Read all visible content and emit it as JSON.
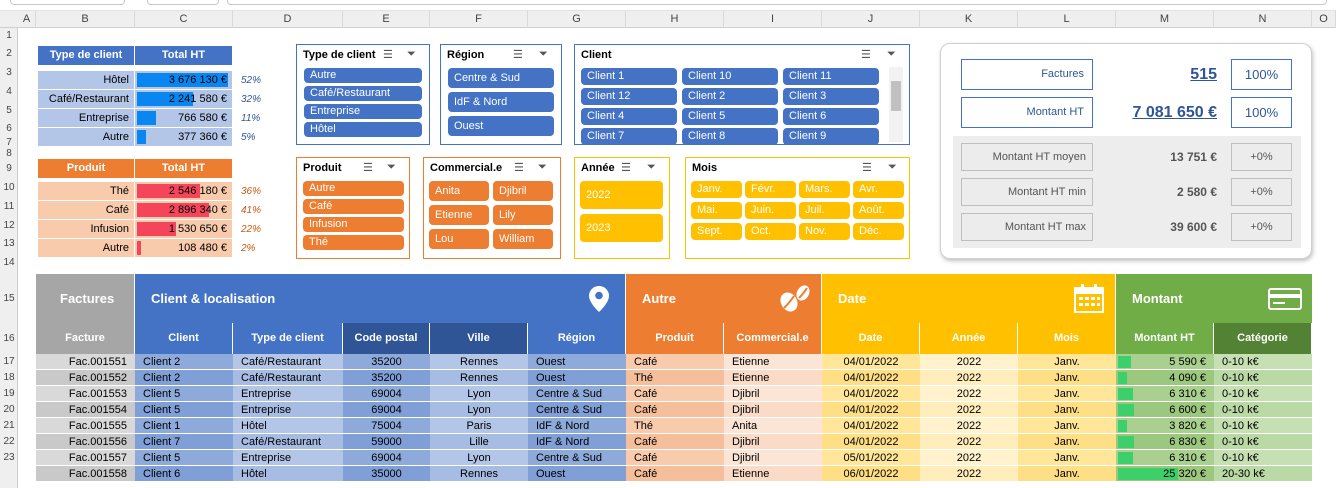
{
  "columns": [
    "A",
    "B",
    "C",
    "D",
    "E",
    "F",
    "G",
    "H",
    "I",
    "J",
    "K",
    "L",
    "M",
    "N",
    "O"
  ],
  "rows": [
    "1",
    "2",
    "3",
    "4",
    "5",
    "6",
    "7",
    "8",
    "9",
    "10",
    "11",
    "12",
    "13",
    "14",
    "15",
    "16",
    "17",
    "18",
    "19",
    "20",
    "21",
    "22",
    "23"
  ],
  "tc_header": {
    "label": "Type de client",
    "total": "Total HT"
  },
  "tc_rows": [
    {
      "label": "Hôtel",
      "value": "3 676 130 €",
      "pct": "52%",
      "bar": 0.52
    },
    {
      "label": "Café/Restaurant",
      "value": "2 241 580 €",
      "pct": "32%",
      "bar": 0.32
    },
    {
      "label": "Entreprise",
      "value": "766 580 €",
      "pct": "11%",
      "bar": 0.11
    },
    {
      "label": "Autre",
      "value": "377 360 €",
      "pct": "5%",
      "bar": 0.05
    }
  ],
  "pr_header": {
    "label": "Produit",
    "total": "Total HT"
  },
  "pr_rows": [
    {
      "label": "Thé",
      "value": "2 546 180 €",
      "pct": "36%",
      "bar": 0.36
    },
    {
      "label": "Café",
      "value": "2 896 340 €",
      "pct": "41%",
      "bar": 0.41
    },
    {
      "label": "Infusion",
      "value": "1 530 650 €",
      "pct": "22%",
      "bar": 0.22
    },
    {
      "label": "Autre",
      "value": "108 480 €",
      "pct": "2%",
      "bar": 0.02
    }
  ],
  "slicers": {
    "type_client": {
      "title": "Type de client",
      "items": [
        "Autre",
        "Café/Restaurant",
        "Entreprise",
        "Hôtel"
      ]
    },
    "region": {
      "title": "Région",
      "items": [
        "Centre & Sud",
        "IdF & Nord",
        "Ouest"
      ]
    },
    "client": {
      "title": "Client",
      "items": [
        "Client 1",
        "Client 10",
        "Client 11",
        "Client 12",
        "Client 2",
        "Client 3",
        "Client 4",
        "Client 5",
        "Client 6",
        "Client 7",
        "Client 8",
        "Client 9"
      ]
    },
    "produit": {
      "title": "Produit",
      "items": [
        "Autre",
        "Café",
        "Infusion",
        "Thé"
      ]
    },
    "commercial": {
      "title": "Commercial.e",
      "items": [
        "Anita",
        "Djibril",
        "Etienne",
        "Lily",
        "Lou",
        "William"
      ]
    },
    "annee": {
      "title": "Année",
      "items": [
        "2022",
        "2023"
      ]
    },
    "mois": {
      "title": "Mois",
      "items": [
        "Janv.",
        "Févr.",
        "Mars.",
        "Avr.",
        "Mai.",
        "Juin.",
        "Juil.",
        "Août.",
        "Sept.",
        "Oct.",
        "Nov.",
        "Déc."
      ]
    }
  },
  "kpi": {
    "factures": {
      "label": "Factures",
      "value": "515",
      "pct": "100%"
    },
    "montant": {
      "label": "Montant HT",
      "value": "7 081 650 €",
      "pct": "100%"
    },
    "moyen": {
      "label": "Montant HT moyen",
      "value": "13 751 €",
      "delta": "+0%"
    },
    "min": {
      "label": "Montant HT min",
      "value": "2 580 €",
      "delta": "+0%"
    },
    "max": {
      "label": "Montant HT max",
      "value": "39 600 €",
      "delta": "+0%"
    }
  },
  "bands": {
    "factures": "Factures",
    "client": "Client & localisation",
    "autre": "Autre",
    "date": "Date",
    "montant": "Montant"
  },
  "headers": [
    "Facture",
    "Client",
    "Type de client",
    "Code postal",
    "Ville",
    "Région",
    "Produit",
    "Commercial.e",
    "Date",
    "Année",
    "Mois",
    "Montant HT",
    "Catégorie"
  ],
  "table": [
    [
      "Fac.001551",
      "Client 2",
      "Café/Restaurant",
      "35200",
      "Rennes",
      "Ouest",
      "Café",
      "Etienne",
      "04/01/2022",
      "2022",
      "Janv.",
      "5 590 €",
      "0-10 k€"
    ],
    [
      "Fac.001552",
      "Client 2",
      "Café/Restaurant",
      "35200",
      "Rennes",
      "Ouest",
      "Thé",
      "Etienne",
      "04/01/2022",
      "2022",
      "Janv.",
      "4 090 €",
      "0-10 k€"
    ],
    [
      "Fac.001553",
      "Client 5",
      "Entreprise",
      "69004",
      "Lyon",
      "Centre & Sud",
      "Café",
      "Djibril",
      "04/01/2022",
      "2022",
      "Janv.",
      "6 310 €",
      "0-10 k€"
    ],
    [
      "Fac.001554",
      "Client 5",
      "Entreprise",
      "69004",
      "Lyon",
      "Centre & Sud",
      "Café",
      "Djibril",
      "04/01/2022",
      "2022",
      "Janv.",
      "6 600 €",
      "0-10 k€"
    ],
    [
      "Fac.001555",
      "Client 1",
      "Hôtel",
      "75004",
      "Paris",
      "IdF & Nord",
      "Thé",
      "Anita",
      "04/01/2022",
      "2022",
      "Janv.",
      "3 820 €",
      "0-10 k€"
    ],
    [
      "Fac.001556",
      "Client 7",
      "Café/Restaurant",
      "59000",
      "Lille",
      "IdF & Nord",
      "Café",
      "Djibril",
      "04/01/2022",
      "2022",
      "Janv.",
      "6 830 €",
      "0-10 k€"
    ],
    [
      "Fac.001557",
      "Client 5",
      "Entreprise",
      "69004",
      "Lyon",
      "Centre & Sud",
      "Café",
      "Djibril",
      "05/01/2022",
      "2022",
      "Janv.",
      "6 310 €",
      "0-10 k€"
    ],
    [
      "Fac.001558",
      "Client 6",
      "Hôtel",
      "35000",
      "Rennes",
      "Ouest",
      "Café",
      "Etienne",
      "06/01/2022",
      "2022",
      "Janv.",
      "25 320 €",
      "20-30 k€"
    ]
  ],
  "amount_bars": [
    0.14,
    0.1,
    0.16,
    0.17,
    0.1,
    0.17,
    0.16,
    0.64
  ],
  "colors": {
    "blue": "#4472c4",
    "darkblue": "#2f5597",
    "orange": "#ed7d31",
    "yellow": "#ffc000",
    "green": "#70ad47",
    "gray": "#a6a6a6"
  }
}
